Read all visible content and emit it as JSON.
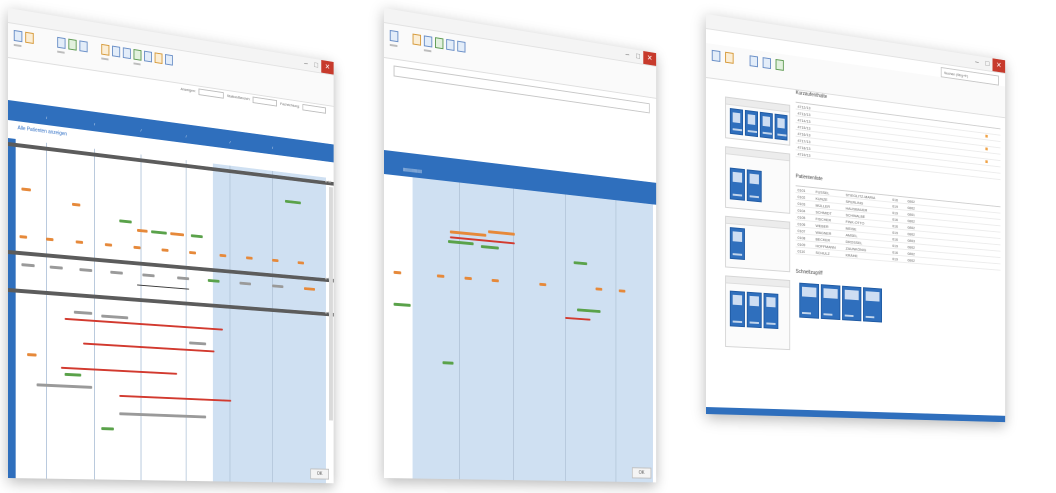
{
  "screens": [
    {
      "id": "ward-planner",
      "ok_label": "OK",
      "filter_labels": [
        "Anzeigen:",
        "Station/Bereich:",
        "Fachrichtung:"
      ],
      "link_text": "Alle Patienten anzeigen"
    },
    {
      "id": "single-timeline",
      "ok_label": "OK"
    },
    {
      "id": "dashboard",
      "search_placeholder": "Suchen (Strg+F)",
      "sections": {
        "top_table_title": "Kurzaufenthalte",
        "bottom_table_title": "Patientenliste",
        "tiles_title": "Schnellzugriff"
      },
      "top_rows": [
        "4712/13",
        "4713/13",
        "4714/13",
        "4715/13",
        "4716/13",
        "4717/13",
        "4718/13",
        "4719/13"
      ],
      "bottom_rows": [
        [
          "0101",
          "FUSSEL",
          "STIEGLITZ-MARIA",
          "016",
          "0802"
        ],
        [
          "0102",
          "KUNZE",
          "SPERLING",
          "019",
          "0802"
        ],
        [
          "0103",
          "MÜLLER",
          "HAUSBAUER",
          "019",
          "0801"
        ],
        [
          "0104",
          "SCHMIDT",
          "SCHWALBE",
          "016",
          "0802"
        ],
        [
          "0105",
          "FISCHER",
          "FINK-OTTO",
          "016",
          "0802"
        ],
        [
          "0106",
          "WEBER",
          "MEISE",
          "019",
          "0802"
        ],
        [
          "0107",
          "WAGNER",
          "AMSEL",
          "016",
          "0803"
        ],
        [
          "0108",
          "BECKER",
          "DROSSEL",
          "019",
          "0802"
        ],
        [
          "0109",
          "HOFFMANN",
          "ZAUNKÖNIG",
          "016",
          "0802"
        ],
        [
          "0110",
          "SCHULZ",
          "KRÄHE",
          "019",
          "0802"
        ]
      ]
    }
  ],
  "icons": [
    "close-icon",
    "minimize-icon",
    "maximize-icon",
    "help-icon",
    "search-icon"
  ],
  "colors": {
    "accent": "#2f6fbd",
    "close": "#c73a2c",
    "bar_orange": "#e6893a",
    "bar_green": "#5aa24a",
    "bar_red": "#d23a2f",
    "shaded_column": "#cfe0f2"
  }
}
